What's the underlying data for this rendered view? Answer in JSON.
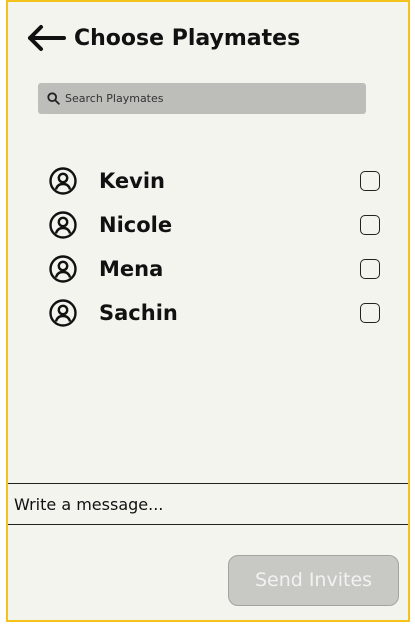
{
  "header": {
    "title": "Choose Playmates",
    "back_icon": "left-arrow-icon"
  },
  "search": {
    "placeholder": "Search Playmates",
    "icon": "search-icon"
  },
  "playmates": [
    {
      "name": "Kevin",
      "checked": false
    },
    {
      "name": "Nicole",
      "checked": false
    },
    {
      "name": "Mena",
      "checked": false
    },
    {
      "name": "Sachin",
      "checked": false
    }
  ],
  "message": {
    "placeholder": "Write a message..."
  },
  "send_button": {
    "label": "Send Invites",
    "disabled": true
  },
  "colors": {
    "frame_border": "#f3c21d",
    "background": "#f4f4ee",
    "search_bg": "#bdbdb9",
    "button_bg": "#c8c8c4"
  }
}
